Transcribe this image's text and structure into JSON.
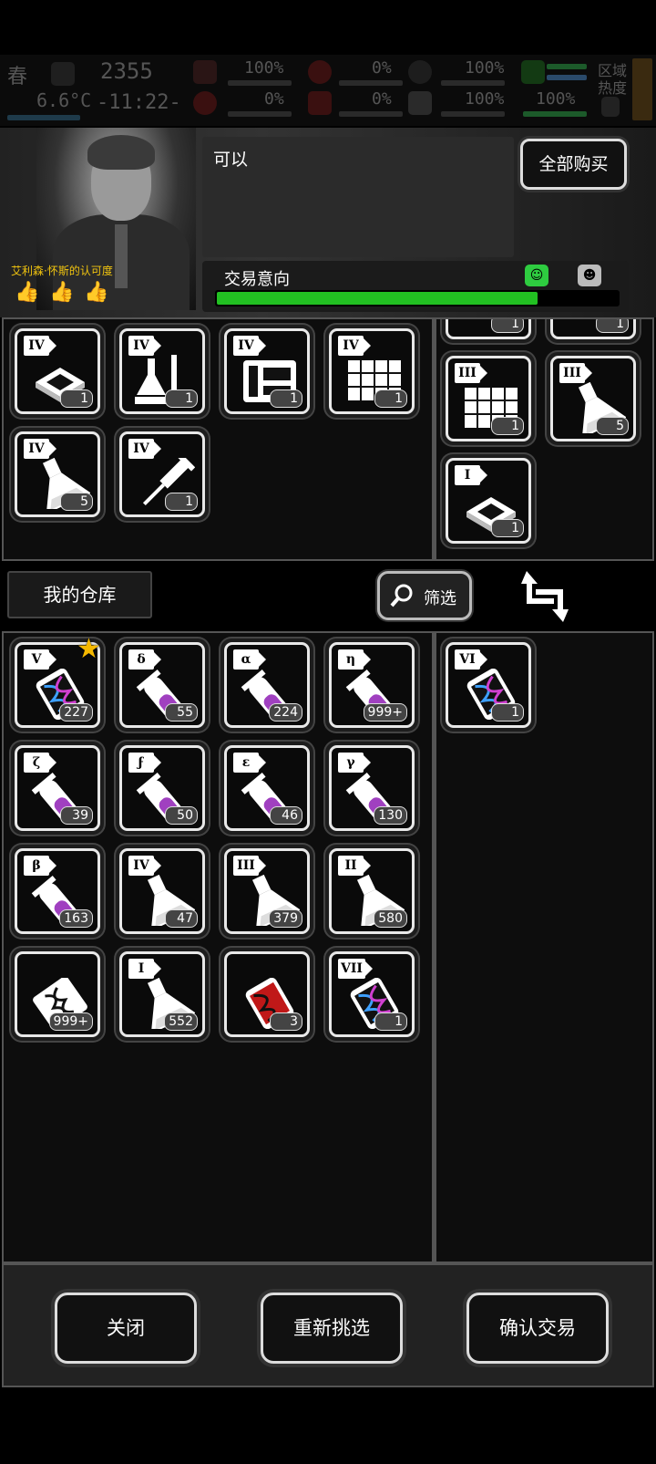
{
  "status": {
    "season": "春",
    "temperature": "6.6°C",
    "day": "2355",
    "time": "-11:22-",
    "stats": [
      "100%",
      "0%",
      "100%",
      "0%",
      "0%",
      "100%",
      "100%"
    ],
    "zone_label": "区域热度"
  },
  "npc": {
    "approval_label": "艾利森·怀斯的认可度",
    "dialog": "可以",
    "thumbs": 3
  },
  "buy_all_label": "全部购买",
  "intent": {
    "label": "交易意向",
    "level": 0.8
  },
  "merchant_items": [
    {
      "tier": "IV",
      "icon": "chip-icon",
      "count": "1"
    },
    {
      "tier": "IV",
      "icon": "lab-equipment-icon",
      "count": "1"
    },
    {
      "tier": "IV",
      "icon": "machine-icon",
      "count": "1"
    },
    {
      "tier": "IV",
      "icon": "grid-panel-icon",
      "count": "1"
    },
    {
      "tier": "IV",
      "icon": "flask-icon",
      "count": "5"
    },
    {
      "tier": "IV",
      "icon": "syringe-icon",
      "count": "1"
    }
  ],
  "offer_items": [
    {
      "tier": "",
      "icon": "partial-item-icon",
      "count": "1"
    },
    {
      "tier": "",
      "icon": "partial-item-icon",
      "count": "1"
    },
    {
      "tier": "III",
      "icon": "grid-panel-icon",
      "count": "1"
    },
    {
      "tier": "III",
      "icon": "flask-icon",
      "count": "5"
    },
    {
      "tier": "I",
      "icon": "chip-icon",
      "count": "1"
    }
  ],
  "warehouse_label": "我的仓库",
  "filter_label": "筛选",
  "inventory": [
    {
      "tier": "V",
      "icon": "dna-vial-icon",
      "count": "227",
      "starred": true
    },
    {
      "tier": "δ",
      "icon": "test-tube-icon",
      "count": "55"
    },
    {
      "tier": "α",
      "icon": "test-tube-icon",
      "count": "224"
    },
    {
      "tier": "η",
      "icon": "test-tube-icon",
      "count": "999+"
    },
    {
      "tier": "ζ",
      "icon": "test-tube-icon",
      "count": "39"
    },
    {
      "tier": "ϝ",
      "icon": "test-tube-icon",
      "count": "50"
    },
    {
      "tier": "ε",
      "icon": "test-tube-icon",
      "count": "46"
    },
    {
      "tier": "γ",
      "icon": "test-tube-icon",
      "count": "130"
    },
    {
      "tier": "β",
      "icon": "test-tube-icon",
      "count": "163"
    },
    {
      "tier": "IV",
      "icon": "flask-icon",
      "count": "47"
    },
    {
      "tier": "III",
      "icon": "flask-icon",
      "count": "379"
    },
    {
      "tier": "II",
      "icon": "flask-icon",
      "count": "580"
    },
    {
      "tier": "",
      "icon": "dna-sample-card-icon",
      "count": "999+"
    },
    {
      "tier": "I",
      "icon": "flask-icon",
      "count": "552"
    },
    {
      "tier": "",
      "icon": "red-dna-vial-icon",
      "count": "3"
    },
    {
      "tier": "VII",
      "icon": "dna-vial-icon",
      "count": "1"
    }
  ],
  "sell_items": [
    {
      "tier": "VI",
      "icon": "dna-vial-icon",
      "count": "1"
    }
  ],
  "buttons": {
    "close": "关闭",
    "reselect": "重新挑选",
    "confirm": "确认交易"
  },
  "colors": {
    "intent_good": "#22c022",
    "potion": "#a040c0",
    "star": "#f5b800"
  }
}
